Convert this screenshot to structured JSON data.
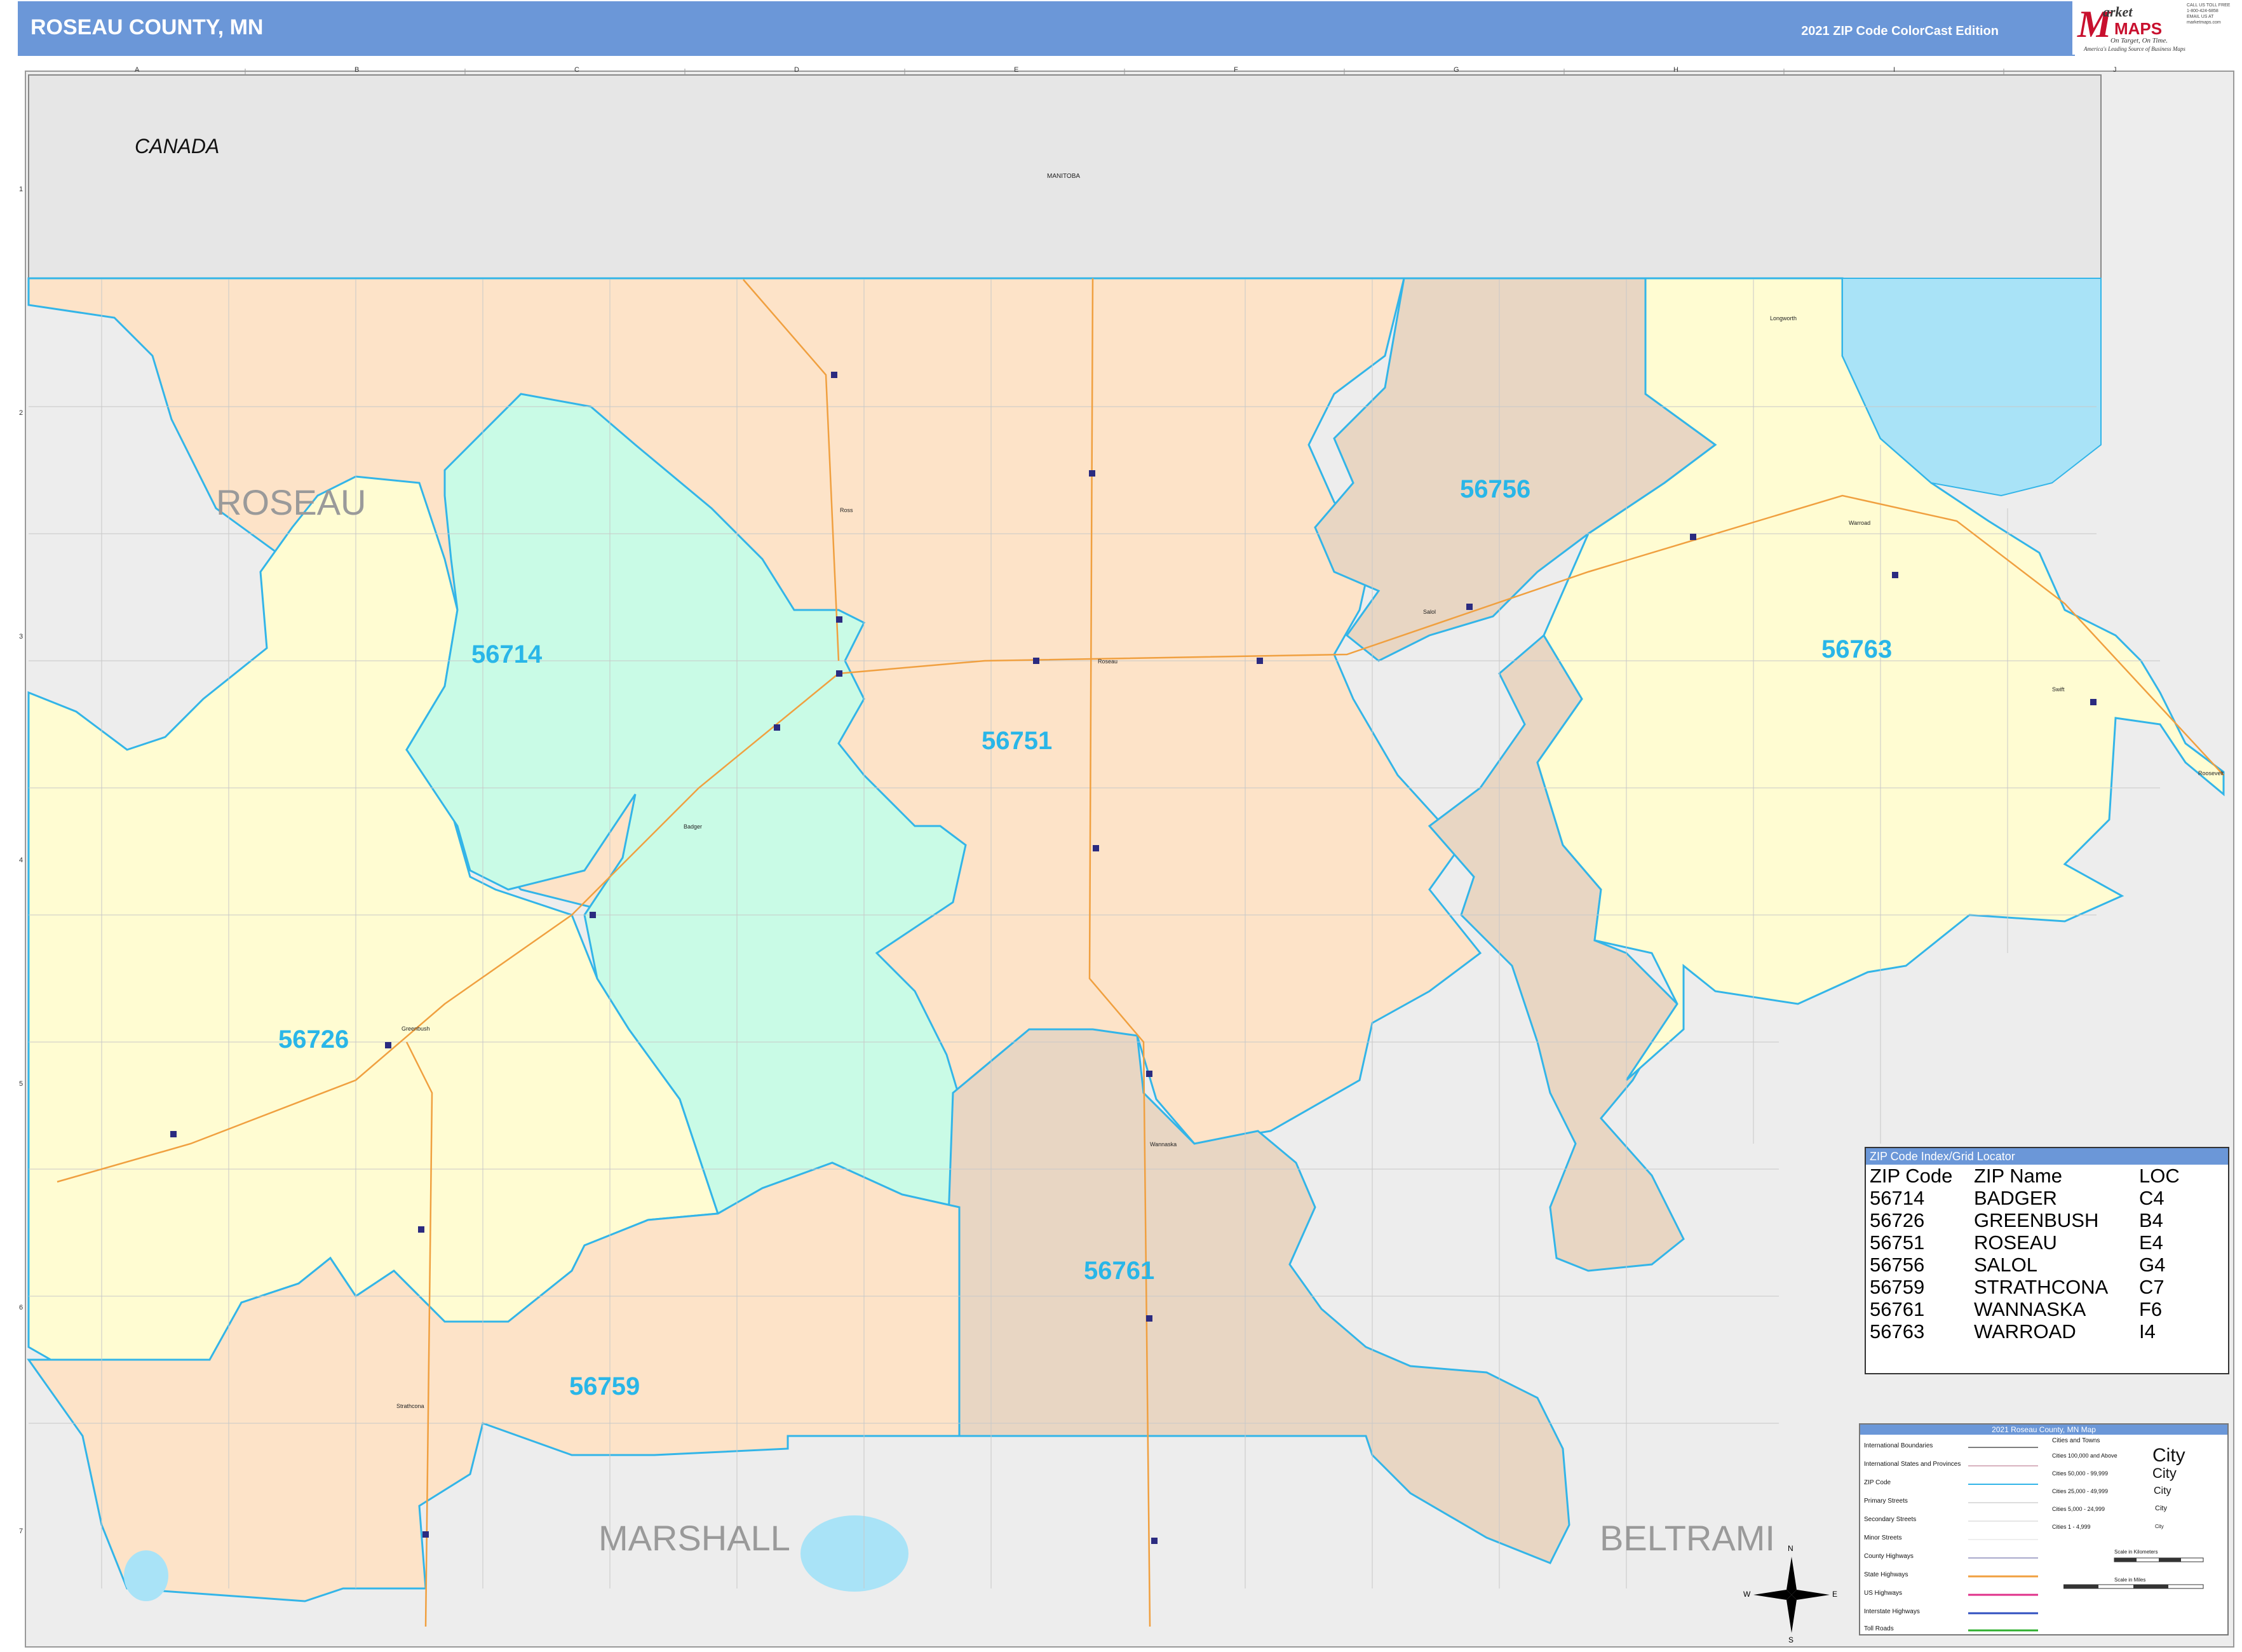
{
  "header": {
    "title": "ROSEAU COUNTY, MN",
    "edition": "2021 ZIP Code ColorCast Edition",
    "logo_letter": "M",
    "logo_market": "arket",
    "logo_maps": "MAPS",
    "logo_tagline": "On Target, On Time.",
    "logo_tagline2": "America's Leading Source of Business Maps",
    "contact_line1": "CALL US TOLL FREE",
    "contact_line2": "1-800-424-6858",
    "contact_line3": "EMAIL US AT",
    "contact_line4": "marketmaps.com"
  },
  "colors": {
    "header_blue": "#6b97d8",
    "zip_label": "#29b6e8",
    "zip_boundary": "#33b5e8",
    "zone_peach": "#fde3c8",
    "zone_yellow": "#fffcd2",
    "zone_mint": "#c9fbe6",
    "zone_tan": "#e8d6c3",
    "outside": "#ededed",
    "water": "#a9e3f7"
  },
  "grid": {
    "columns": [
      "A",
      "B",
      "C",
      "D",
      "E",
      "F",
      "G",
      "H",
      "I",
      "J"
    ],
    "rows": [
      "1",
      "2",
      "3",
      "4",
      "5",
      "6",
      "7"
    ]
  },
  "map": {
    "country_label": "CANADA",
    "province_label": "MANITOBA",
    "county_labels": {
      "roseau": "ROSEAU",
      "marshall": "MARSHALL",
      "beltrami": "BELTRAMI"
    },
    "zip_labels": [
      {
        "zip": "56714"
      },
      {
        "zip": "56751"
      },
      {
        "zip": "56756"
      },
      {
        "zip": "56763"
      },
      {
        "zip": "56726"
      },
      {
        "zip": "56761"
      },
      {
        "zip": "56759"
      }
    ],
    "city_labels": [
      "Roseau",
      "Badger",
      "Greenbush",
      "Wannaska",
      "Salol",
      "Warroad",
      "Strathcona",
      "Ross",
      "Longworth",
      "Swift",
      "Roosevelt"
    ]
  },
  "zip_index": {
    "title": "ZIP Code Index/Grid Locator",
    "headers": [
      "ZIP Code",
      "ZIP Name",
      "LOC"
    ],
    "rows": [
      [
        "56714",
        "BADGER",
        "C4"
      ],
      [
        "56726",
        "GREENBUSH",
        "B4"
      ],
      [
        "56751",
        "ROSEAU",
        "E4"
      ],
      [
        "56756",
        "SALOL",
        "G4"
      ],
      [
        "56759",
        "STRATHCONA",
        "C7"
      ],
      [
        "56761",
        "WANNASKA",
        "F6"
      ],
      [
        "56763",
        "WARROAD",
        "I4"
      ]
    ]
  },
  "legend": {
    "title": "2021 Roseau County, MN Map",
    "items": [
      "International Boundaries",
      "International States and Provinces",
      "ZIP Code",
      "Primary Streets",
      "Secondary Streets",
      "Minor Streets",
      "County Highways",
      "State Highways",
      "US Highways",
      "Interstate Highways",
      "Toll Roads"
    ],
    "cities_header": "Cities and Towns",
    "cities": [
      {
        "range": "Cities 100,000 and Above",
        "sample": "City"
      },
      {
        "range": "Cities 50,000 - 99,999",
        "sample": "City"
      },
      {
        "range": "Cities 25,000 - 49,999",
        "sample": "City"
      },
      {
        "range": "Cities 5,000 - 24,999",
        "sample": "City"
      },
      {
        "range": "Cities 1 - 4,999",
        "sample": "City"
      }
    ],
    "scale_km": "Scale in Kilometers",
    "scale_mi": "Scale in Miles"
  },
  "compass": {
    "n": "N",
    "s": "S",
    "e": "E",
    "w": "W"
  }
}
